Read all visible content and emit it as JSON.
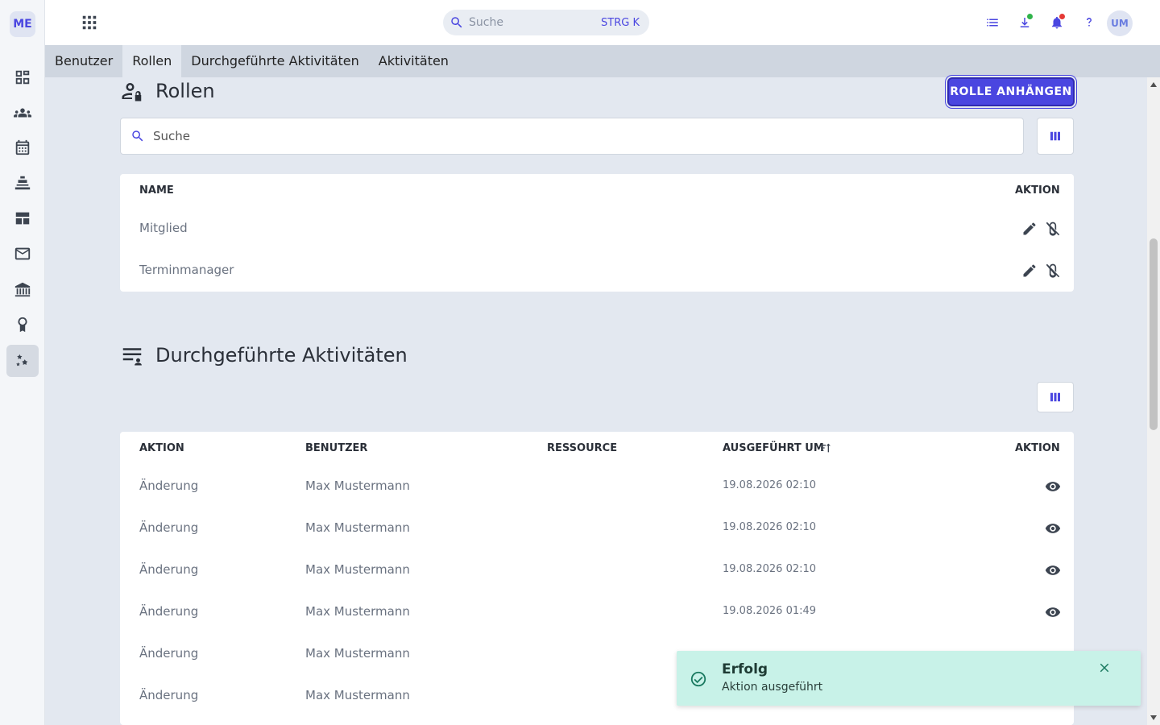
{
  "app": {
    "logo": "ME",
    "avatar": "UM"
  },
  "search": {
    "placeholder": "Suche",
    "shortcut": "STRG K"
  },
  "sidebar": {
    "items": [
      {
        "icon": "dashboard-icon"
      },
      {
        "icon": "groups-icon"
      },
      {
        "icon": "calendar-icon"
      },
      {
        "icon": "training-icon"
      },
      {
        "icon": "table-icon"
      },
      {
        "icon": "mail-icon"
      },
      {
        "icon": "building-icon"
      },
      {
        "icon": "award-icon"
      },
      {
        "icon": "settings-icon",
        "active": true
      }
    ]
  },
  "tabs": [
    "Benutzer",
    "Rollen",
    "Durchgeführte Aktivitäten",
    "Aktivitäten"
  ],
  "roles": {
    "title": "Rollen",
    "attach_button": "ROLLE ANHÄNGEN",
    "search_placeholder": "Suche",
    "columns": {
      "name": "NAME",
      "action": "AKTION"
    },
    "rows": [
      {
        "name": "Mitglied"
      },
      {
        "name": "Terminmanager"
      }
    ]
  },
  "activities": {
    "title": "Durchgeführte Aktivitäten",
    "columns": {
      "action": "AKTION",
      "user": "BENUTZER",
      "resource": "RESSOURCE",
      "executed_at": "AUSGEFÜHRT UM",
      "action2": "AKTION"
    },
    "rows": [
      {
        "action": "Änderung",
        "user": "Max Mustermann",
        "resource": "",
        "executed_at": "19.08.2026 02:10"
      },
      {
        "action": "Änderung",
        "user": "Max Mustermann",
        "resource": "",
        "executed_at": "19.08.2026 02:10"
      },
      {
        "action": "Änderung",
        "user": "Max Mustermann",
        "resource": "",
        "executed_at": "19.08.2026 02:10"
      },
      {
        "action": "Änderung",
        "user": "Max Mustermann",
        "resource": "",
        "executed_at": "19.08.2026 01:49"
      },
      {
        "action": "Änderung",
        "user": "Max Mustermann",
        "resource": "",
        "executed_at": ""
      },
      {
        "action": "Änderung",
        "user": "Max Mustermann",
        "resource": "",
        "executed_at": ""
      }
    ]
  },
  "toast": {
    "title": "Erfolg",
    "message": "Aktion ausgeführt"
  },
  "colors": {
    "accent": "#4a46e0",
    "toast_bg": "#c8f2e8",
    "success": "#1a7a60"
  }
}
